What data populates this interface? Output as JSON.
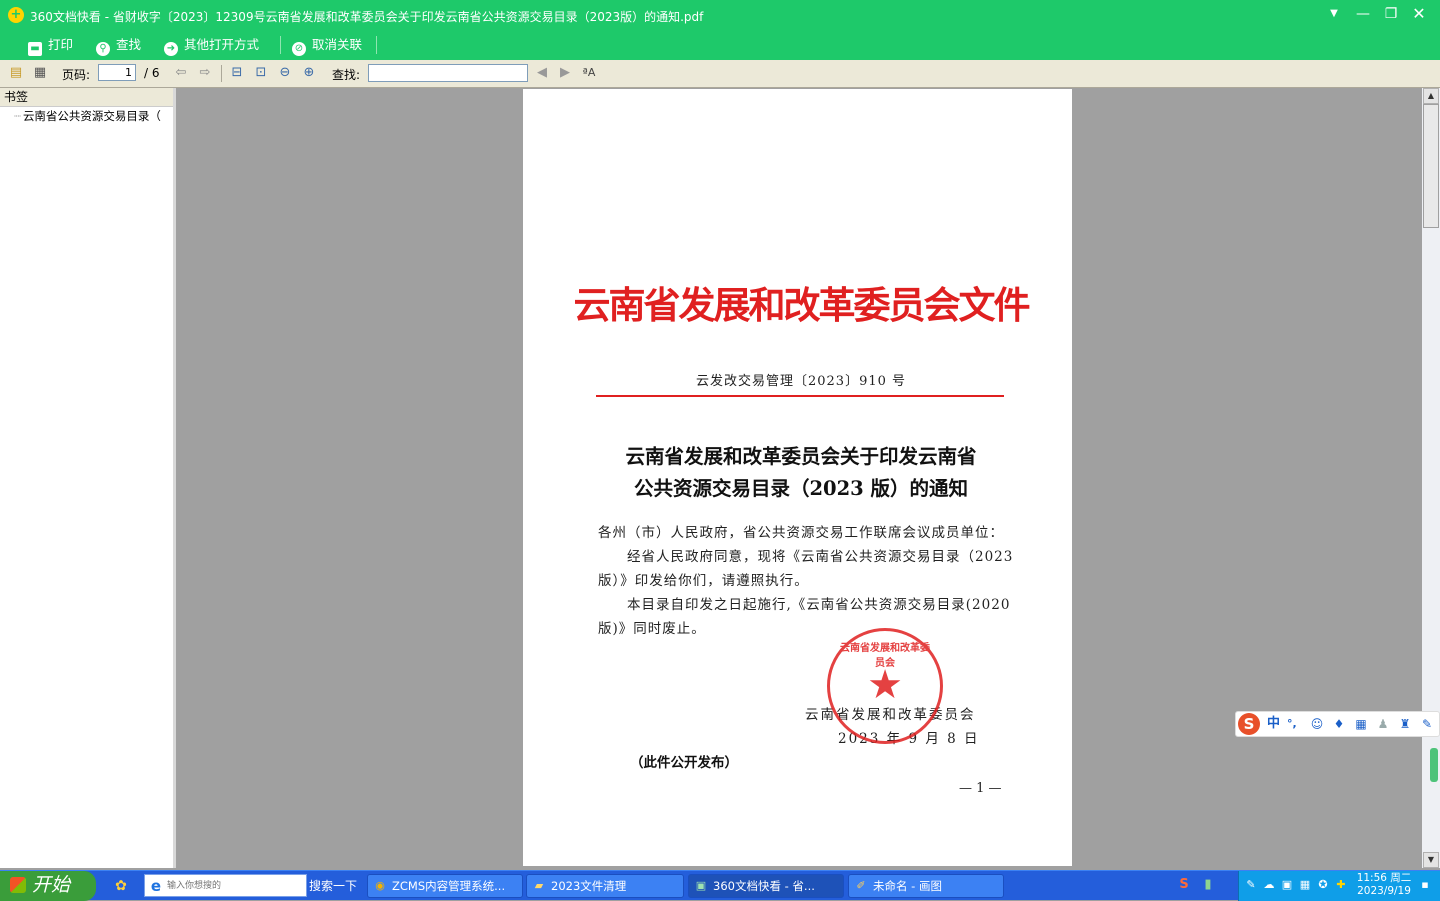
{
  "window": {
    "title": "360文档快看 - 省财收字〔2023〕12309号云南省发展和改革委员会关于印发云南省公共资源交易目录（2023版）的通知.pdf",
    "controls": {
      "dropdown": "▼",
      "minimize": "—",
      "maximize": "❐",
      "close": "✕"
    }
  },
  "green_toolbar": {
    "print": "打印",
    "find": "查找",
    "open_with": "其他打开方式",
    "unlink": "取消关联"
  },
  "toolbar": {
    "page_label": "页码:",
    "page_current": "1",
    "page_total": "/ 6",
    "find_label": "查找:",
    "find_value": ""
  },
  "sidebar": {
    "header": "书签",
    "items": [
      {
        "label": "云南省公共资源交易目录（"
      }
    ]
  },
  "document": {
    "header": "云南省发展和改革委员会文件",
    "number": "云发改交易管理〔2023〕910 号",
    "title_line1": "云南省发展和改革委员会关于印发云南省",
    "title_line2": "公共资源交易目录（2023 版）的通知",
    "body": [
      "各州（市）人民政府，省公共资源交易工作联席会议成员单位：",
      "经省人民政府同意，现将《云南省公共资源交易目录（2023",
      "版）》印发给你们，请遵照执行。",
      "本目录自印发之日起施行,《云南省公共资源交易目录(2020",
      "版)》同时废止。"
    ],
    "stamp_text": "云南省发展和改革委员会",
    "sign_org": "云南省发展和改革委员会",
    "sign_date": "2023 年 9 月 8 日",
    "public_note": "（此件公开发布）",
    "page_number": "— 1 —"
  },
  "ime": {
    "items": [
      "中",
      "°,"
    ]
  },
  "taskbar": {
    "start": "开始",
    "search_placeholder": "输入你想搜的",
    "search_button": "搜索一下",
    "tasks": [
      {
        "label": "ZCMS内容管理系统..."
      },
      {
        "label": "2023文件清理"
      },
      {
        "label": "360文档快看 - 省..."
      },
      {
        "label": "未命名 - 画图"
      }
    ],
    "clock_time": "11:56 周二",
    "clock_date": "2023/9/19"
  },
  "colors": {
    "accent": "#1ec96a",
    "document_red": "#e02020",
    "taskbar": "#245edb",
    "tray": "#0f9ee8"
  }
}
